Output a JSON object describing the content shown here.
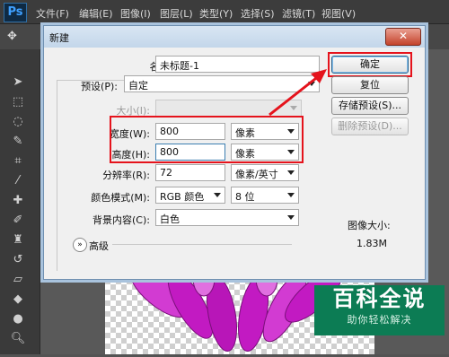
{
  "app": {
    "logo": "Ps"
  },
  "menubar": {
    "items": [
      "文件(F)",
      "编辑(E)",
      "图像(I)",
      "图层(L)",
      "类型(Y)",
      "选择(S)",
      "滤镜(T)",
      "视图(V)"
    ]
  },
  "dialog": {
    "title": "新建",
    "close_glyph": "✕",
    "name_label": "名称(N):",
    "name_value": "未标题-1",
    "preset_label": "预设(P):",
    "preset_value": "自定",
    "size_label": "大小(I):",
    "size_value": "",
    "width_label": "宽度(W):",
    "width_value": "800",
    "width_unit": "像素",
    "height_label": "高度(H):",
    "height_value": "800",
    "height_unit": "像素",
    "resolution_label": "分辨率(R):",
    "resolution_value": "72",
    "resolution_unit": "像素/英寸",
    "color_mode_label": "颜色模式(M):",
    "color_mode_value": "RGB 颜色",
    "bit_depth_value": "8 位",
    "background_label": "背景内容(C):",
    "background_value": "白色",
    "advanced_label": "高级",
    "image_size_label": "图像大小:",
    "image_size_value": "1.83M",
    "buttons": {
      "ok": "确定",
      "reset": "复位",
      "save_preset": "存储预设(S)...",
      "delete_preset": "删除预设(D)..."
    }
  },
  "watermark": {
    "title": "百科全说",
    "subtitle": "助你轻松解决"
  },
  "colors": {
    "highlight": "#e5131c",
    "watermark_bg": "#0c7c54",
    "ps_chrome": "#3c3c3c"
  }
}
